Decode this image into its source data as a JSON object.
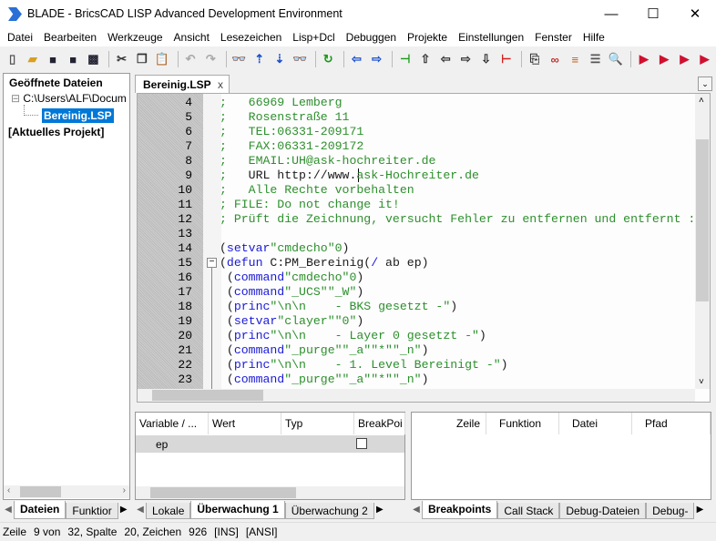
{
  "window": {
    "title": "BLADE - BricsCAD LISP Advanced Development Environment",
    "minimize": "—",
    "maximize": "☐",
    "close": "✕"
  },
  "menu": [
    "Datei",
    "Bearbeiten",
    "Werkzeuge",
    "Ansicht",
    "Lesezeichen",
    "Lisp+Dcl",
    "Debuggen",
    "Projekte",
    "Einstellungen",
    "Fenster",
    "Hilfe"
  ],
  "toolbar": [
    {
      "icon": "new-file-icon",
      "g": "▯",
      "c": "#555"
    },
    {
      "icon": "open-folder-icon",
      "g": "▰",
      "c": "#d8a020"
    },
    {
      "icon": "save-icon",
      "g": "■",
      "c": "#223"
    },
    {
      "icon": "save-as-icon",
      "g": "■",
      "c": "#223"
    },
    {
      "icon": "save-all-icon",
      "g": "▩",
      "c": "#223"
    },
    {
      "sep": true
    },
    {
      "icon": "cut-icon",
      "g": "✂",
      "c": "#333"
    },
    {
      "icon": "copy-icon",
      "g": "❐",
      "c": "#333"
    },
    {
      "icon": "paste-icon",
      "g": "📋",
      "c": "#333"
    },
    {
      "sep": true
    },
    {
      "icon": "undo-icon",
      "g": "↶",
      "c": "#aaa"
    },
    {
      "icon": "redo-icon",
      "g": "↷",
      "c": "#aaa"
    },
    {
      "sep": true
    },
    {
      "icon": "find-icon",
      "g": "👓",
      "c": "#222"
    },
    {
      "icon": "find-up-icon",
      "g": "⇡",
      "c": "#1a4fd0"
    },
    {
      "icon": "find-down-icon",
      "g": "⇣",
      "c": "#1a4fd0"
    },
    {
      "icon": "replace-icon",
      "g": "👓",
      "c": "#222"
    },
    {
      "sep": true
    },
    {
      "icon": "refresh-icon",
      "g": "↻",
      "c": "#1a9a1a"
    },
    {
      "sep": true
    },
    {
      "icon": "back-icon",
      "g": "⇦",
      "c": "#1a4fd0"
    },
    {
      "icon": "forward-icon",
      "g": "⇨",
      "c": "#1a4fd0"
    },
    {
      "sep": true
    },
    {
      "icon": "bookmark-add-icon",
      "g": "⊣",
      "c": "#1a9a1a"
    },
    {
      "icon": "arrow-up-icon",
      "g": "⇧",
      "c": "#333"
    },
    {
      "icon": "arrow-left-icon",
      "g": "⇦",
      "c": "#333"
    },
    {
      "icon": "arrow-right-icon",
      "g": "⇨",
      "c": "#333"
    },
    {
      "icon": "arrow-down-icon",
      "g": "⇩",
      "c": "#333"
    },
    {
      "icon": "bookmark-remove-icon",
      "g": "⊢",
      "c": "#d02020"
    },
    {
      "sep": true
    },
    {
      "icon": "load-icon",
      "g": "⎘",
      "c": "#333"
    },
    {
      "icon": "link-icon",
      "g": "∞",
      "c": "#c03030"
    },
    {
      "icon": "format-icon",
      "g": "≡",
      "c": "#c06020"
    },
    {
      "icon": "list-icon",
      "g": "☰",
      "c": "#555"
    },
    {
      "icon": "zoom-icon",
      "g": "🔍",
      "c": "#333"
    },
    {
      "sep": true
    },
    {
      "icon": "debug-run-icon",
      "g": "▶",
      "c": "#d01030"
    },
    {
      "icon": "debug-step-icon",
      "g": "▶",
      "c": "#d01030"
    },
    {
      "icon": "run-icon",
      "g": "▶",
      "c": "#d01030"
    },
    {
      "icon": "run-to-icon",
      "g": "▶",
      "c": "#d01030"
    }
  ],
  "left": {
    "header": "Geöffnete Dateien",
    "path": "C:\\Users\\ALF\\Docum",
    "file": "Bereinig.LSP",
    "project": "[Aktuelles Projekt]",
    "tabs": [
      "Dateien",
      "Funktior"
    ]
  },
  "editor": {
    "tab": "Bereinig.LSP",
    "tab_close": "x",
    "lines": [
      {
        "n": "4",
        "tokens": [
          [
            "cm",
            ";   66969 Lemberg"
          ]
        ]
      },
      {
        "n": "5",
        "tokens": [
          [
            "cm",
            ";   Rosenstraße 11"
          ]
        ]
      },
      {
        "n": "6",
        "tokens": [
          [
            "cm",
            ";   TEL:06331-209171"
          ]
        ]
      },
      {
        "n": "7",
        "tokens": [
          [
            "cm",
            ";   FAX:06331-209172"
          ]
        ]
      },
      {
        "n": "8",
        "tokens": [
          [
            "cm",
            ";   EMAIL:UH@ask-hochreiter.de"
          ]
        ]
      },
      {
        "n": "9",
        "tokens": [
          [
            "cm",
            ";   "
          ],
          [
            "tx",
            "URL http://www."
          ],
          [
            "cm",
            "ask-Hochreiter.de"
          ]
        ]
      },
      {
        "n": "10",
        "tokens": [
          [
            "cm",
            ";   Alle Rechte vorbehalten"
          ]
        ]
      },
      {
        "n": "11",
        "tokens": [
          [
            "cm",
            "; FILE: Do not change it!"
          ]
        ]
      },
      {
        "n": "12",
        "tokens": [
          [
            "cm",
            "; Prüft die Zeichnung, versucht Fehler zu entfernen und entfernt :"
          ]
        ]
      },
      {
        "n": "13",
        "tokens": []
      },
      {
        "n": "14",
        "tokens": [
          [
            "pn",
            "("
          ],
          [
            "kw",
            "setvar"
          ],
          [
            "st",
            "\"cmdecho\"0"
          ],
          [
            "pn",
            ")"
          ]
        ]
      },
      {
        "n": "15",
        "tokens": [
          [
            "pn",
            "("
          ],
          [
            "kw",
            "defun"
          ],
          [
            "tx",
            " C:PM_Bereinig"
          ],
          [
            "pn",
            "("
          ],
          [
            "kw",
            "/"
          ],
          [
            "tx",
            " ab ep"
          ],
          [
            "pn",
            ")"
          ]
        ]
      },
      {
        "n": "16",
        "tokens": [
          [
            "pn",
            " ("
          ],
          [
            "kw",
            "command"
          ],
          [
            "st",
            "\"cmdecho\"0"
          ],
          [
            "pn",
            ")"
          ]
        ]
      },
      {
        "n": "17",
        "tokens": [
          [
            "pn",
            " ("
          ],
          [
            "kw",
            "command"
          ],
          [
            "st",
            "\"_UCS\"\"_W\""
          ],
          [
            "pn",
            ")"
          ]
        ]
      },
      {
        "n": "18",
        "tokens": [
          [
            "pn",
            " ("
          ],
          [
            "kw",
            "princ"
          ],
          [
            "st",
            "\"\\n\\n    - BKS gesetzt -\""
          ],
          [
            "pn",
            ")"
          ]
        ]
      },
      {
        "n": "19",
        "tokens": [
          [
            "pn",
            " ("
          ],
          [
            "kw",
            "setvar"
          ],
          [
            "st",
            "\"clayer\"\"0\""
          ],
          [
            "pn",
            ")"
          ]
        ]
      },
      {
        "n": "20",
        "tokens": [
          [
            "pn",
            " ("
          ],
          [
            "kw",
            "princ"
          ],
          [
            "st",
            "\"\\n\\n    - Layer 0 gesetzt -\""
          ],
          [
            "pn",
            ")"
          ]
        ]
      },
      {
        "n": "21",
        "tokens": [
          [
            "pn",
            " ("
          ],
          [
            "kw",
            "command"
          ],
          [
            "st",
            "\"_purge\"\"_a\"\"*\"\"_n\""
          ],
          [
            "pn",
            ")"
          ]
        ]
      },
      {
        "n": "22",
        "tokens": [
          [
            "pn",
            " ("
          ],
          [
            "kw",
            "princ"
          ],
          [
            "st",
            "\"\\n\\n    - 1. Level Bereinigt -\""
          ],
          [
            "pn",
            ")"
          ]
        ]
      },
      {
        "n": "23",
        "tokens": [
          [
            "pn",
            " ("
          ],
          [
            "kw",
            "command"
          ],
          [
            "st",
            "\"_purge\"\"_a\"\"*\"\"_n\""
          ],
          [
            "pn",
            ")"
          ]
        ]
      }
    ]
  },
  "watch": {
    "columns": [
      "Variable / ...",
      "Wert",
      "Typ",
      "BreakPoi"
    ],
    "rows": [
      {
        "var": "ep",
        "wert": "",
        "typ": "",
        "bp": false
      }
    ],
    "tabs": [
      "Lokale",
      "Überwachung 1",
      "Überwachung 2"
    ]
  },
  "breakpoints": {
    "columns": [
      "Zeile",
      "Funktion",
      "Datei",
      "Pfad"
    ],
    "tabs": [
      "Breakpoints",
      "Call Stack",
      "Debug-Dateien",
      "Debug-"
    ]
  },
  "status": [
    "Zeile",
    "9 von",
    "32, Spalte",
    "20, Zeichen",
    "926",
    "[INS]",
    "[ANSI]"
  ],
  "colors": {
    "comment": "#2d8f2d",
    "keyword": "#1a1ad8",
    "selection": "#0078d7"
  }
}
